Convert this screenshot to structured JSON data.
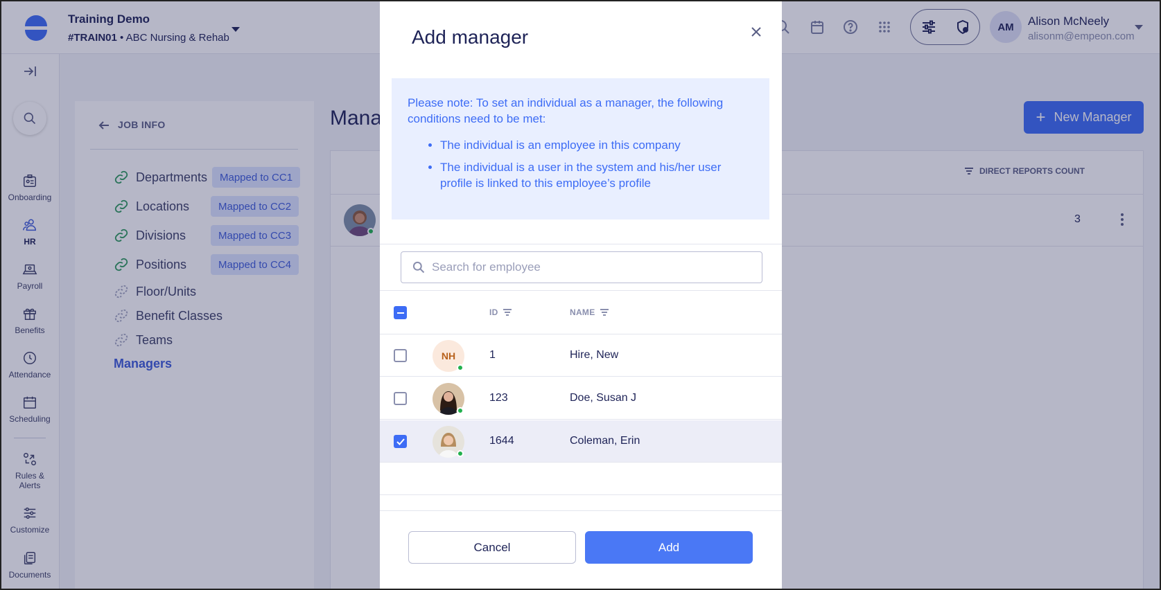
{
  "topbar": {
    "company": "Training Demo",
    "company_code": "#TRAIN01",
    "facility": "ABC Nursing & Rehab",
    "user_initials": "AM",
    "user_name": "Alison McNeely",
    "user_email": "alisonm@empeon.com"
  },
  "sidebar": {
    "items": [
      {
        "label": "Onboarding",
        "icon": "id-card-icon"
      },
      {
        "label": "HR",
        "icon": "people-icon"
      },
      {
        "label": "Payroll",
        "icon": "laptop-icon"
      },
      {
        "label": "Benefits",
        "icon": "gift-icon"
      },
      {
        "label": "Attendance",
        "icon": "clock-icon"
      },
      {
        "label": "Scheduling",
        "icon": "calendar-icon"
      },
      {
        "label": "Rules &",
        "label2": "Alerts",
        "icon": "rules-icon"
      },
      {
        "label": "Customize",
        "icon": "sliders-icon"
      },
      {
        "label": "Documents",
        "icon": "document-icon"
      }
    ]
  },
  "job_info": {
    "back_label": "JOB INFO",
    "items": [
      {
        "label": "Departments",
        "badge": "Mapped to CC1"
      },
      {
        "label": "Locations",
        "badge": "Mapped to CC2"
      },
      {
        "label": "Divisions",
        "badge": "Mapped to CC3"
      },
      {
        "label": "Positions",
        "badge": "Mapped to CC4"
      },
      {
        "label": "Floor/Units"
      },
      {
        "label": "Benefit Classes"
      },
      {
        "label": "Teams"
      },
      {
        "label": "Managers"
      }
    ]
  },
  "main": {
    "title_partial": "Mana",
    "new_button": "New Manager",
    "col_direct_reports": "DIRECT REPORTS COUNT",
    "row_count": "3"
  },
  "modal": {
    "title": "Add manager",
    "note_intro": "Please note: To set an individual as a manager, the following conditions need to be met:",
    "conditions": [
      "The individual is an employee in this company",
      "The individual is a user in the system and his/her user profile is linked to this employee’s profile"
    ],
    "search_placeholder": "Search for employee",
    "col_id": "ID",
    "col_name": "NAME",
    "rows": [
      {
        "initials": "NH",
        "id": "1",
        "name": "Hire, New",
        "checked": false
      },
      {
        "id": "123",
        "name": "Doe, Susan J",
        "checked": false
      },
      {
        "id": "1644",
        "name": "Coleman, Erin",
        "checked": true
      }
    ],
    "cancel": "Cancel",
    "add": "Add"
  },
  "colors": {
    "accent": "#3d6cf5",
    "online": "#22b04e",
    "link_green": "#2e9a5c"
  }
}
